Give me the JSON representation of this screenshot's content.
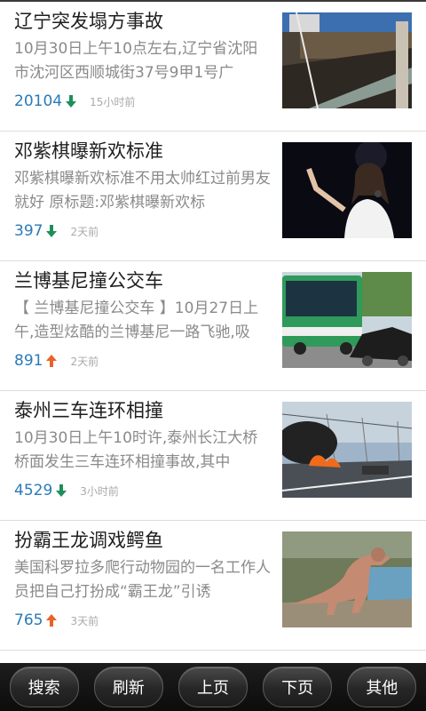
{
  "colors": {
    "count": "#2a7ab8",
    "down_arrow": "#1e8f5a",
    "up_arrow": "#e8632a",
    "toolbar": "#141414"
  },
  "news": [
    {
      "title": "辽宁突发塌方事故",
      "summary": "10月30日上午10点左右,辽宁省沈阳市沈河区西顺城街37号9甲1号广",
      "count": "20104",
      "trend": "down",
      "time": "15小时前",
      "image": "collapse-scene-photo"
    },
    {
      "title": "邓紫棋曝新欢标准",
      "summary": "邓紫棋曝新欢标准不用太帅红过前男友就好 原标题:邓紫棋曝新欢标",
      "count": "397",
      "trend": "down",
      "time": "2天前",
      "image": "singer-on-stage-photo"
    },
    {
      "title": "兰博基尼撞公交车",
      "summary": "【 兰博基尼撞公交车 】10月27日上午,造型炫酷的兰博基尼一路飞驰,吸",
      "count": "891",
      "trend": "up",
      "time": "2天前",
      "image": "bus-and-lamborghini-photo"
    },
    {
      "title": "泰州三车连环相撞",
      "summary": "10月30日上午10时许,泰州长江大桥桥面发生三车连环相撞事故,其中",
      "count": "4529",
      "trend": "down",
      "time": "3小时前",
      "image": "bridge-fire-photo"
    },
    {
      "title": "扮霸王龙调戏鳄鱼",
      "summary": "美国科罗拉多爬行动物园的一名工作人员把自己打扮成“霸王龙”引诱",
      "count": "765",
      "trend": "up",
      "time": "3天前",
      "image": "trex-costume-photo"
    }
  ],
  "toolbar": {
    "search": "搜索",
    "refresh": "刷新",
    "prev": "上页",
    "next": "下页",
    "other": "其他"
  }
}
